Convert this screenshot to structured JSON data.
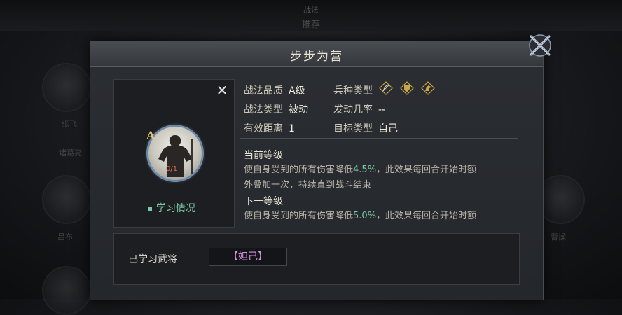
{
  "background": {
    "title": "战法",
    "subtitle": "推荐",
    "left_labels": [
      "张飞",
      "吕布",
      "诸葛亮"
    ],
    "right_labels": [
      "曹操"
    ]
  },
  "dialog": {
    "title": "步步为营",
    "tactic": {
      "quality_label": "战法品质",
      "quality_value": "A级",
      "type_label": "战法类型",
      "type_value": "被动",
      "range_label": "有效距离",
      "range_value": "1",
      "troop_label": "兵种类型",
      "troop_icons": [
        "bow-icon",
        "shield-icon",
        "horse-icon"
      ],
      "rate_label": "发动几率",
      "rate_value": "--",
      "target_label": "目标类型",
      "target_value": "自己"
    },
    "portrait": {
      "grade": "A",
      "progress": "0/1"
    },
    "learn_link": "学习情况",
    "current": {
      "heading": "当前等级",
      "line1_pre": "使自身受到的所有伤害降低",
      "line1_pct": "4.5%",
      "line1_post": "，此效果每回合开始时额",
      "line2": "外叠加一次，持续直到战斗结束"
    },
    "next": {
      "heading": "下一等级",
      "line1_pre": "使自身受到的所有伤害降低",
      "line1_pct": "5.0%",
      "line1_post": "，此效果每回合开始时额"
    },
    "learned_label": "已学习武将",
    "learned_general": "【妲己】"
  },
  "colors": {
    "accent_green": "#78c8a0",
    "general_purple": "#d48fe0",
    "grade_gold": "#e6c56a"
  }
}
